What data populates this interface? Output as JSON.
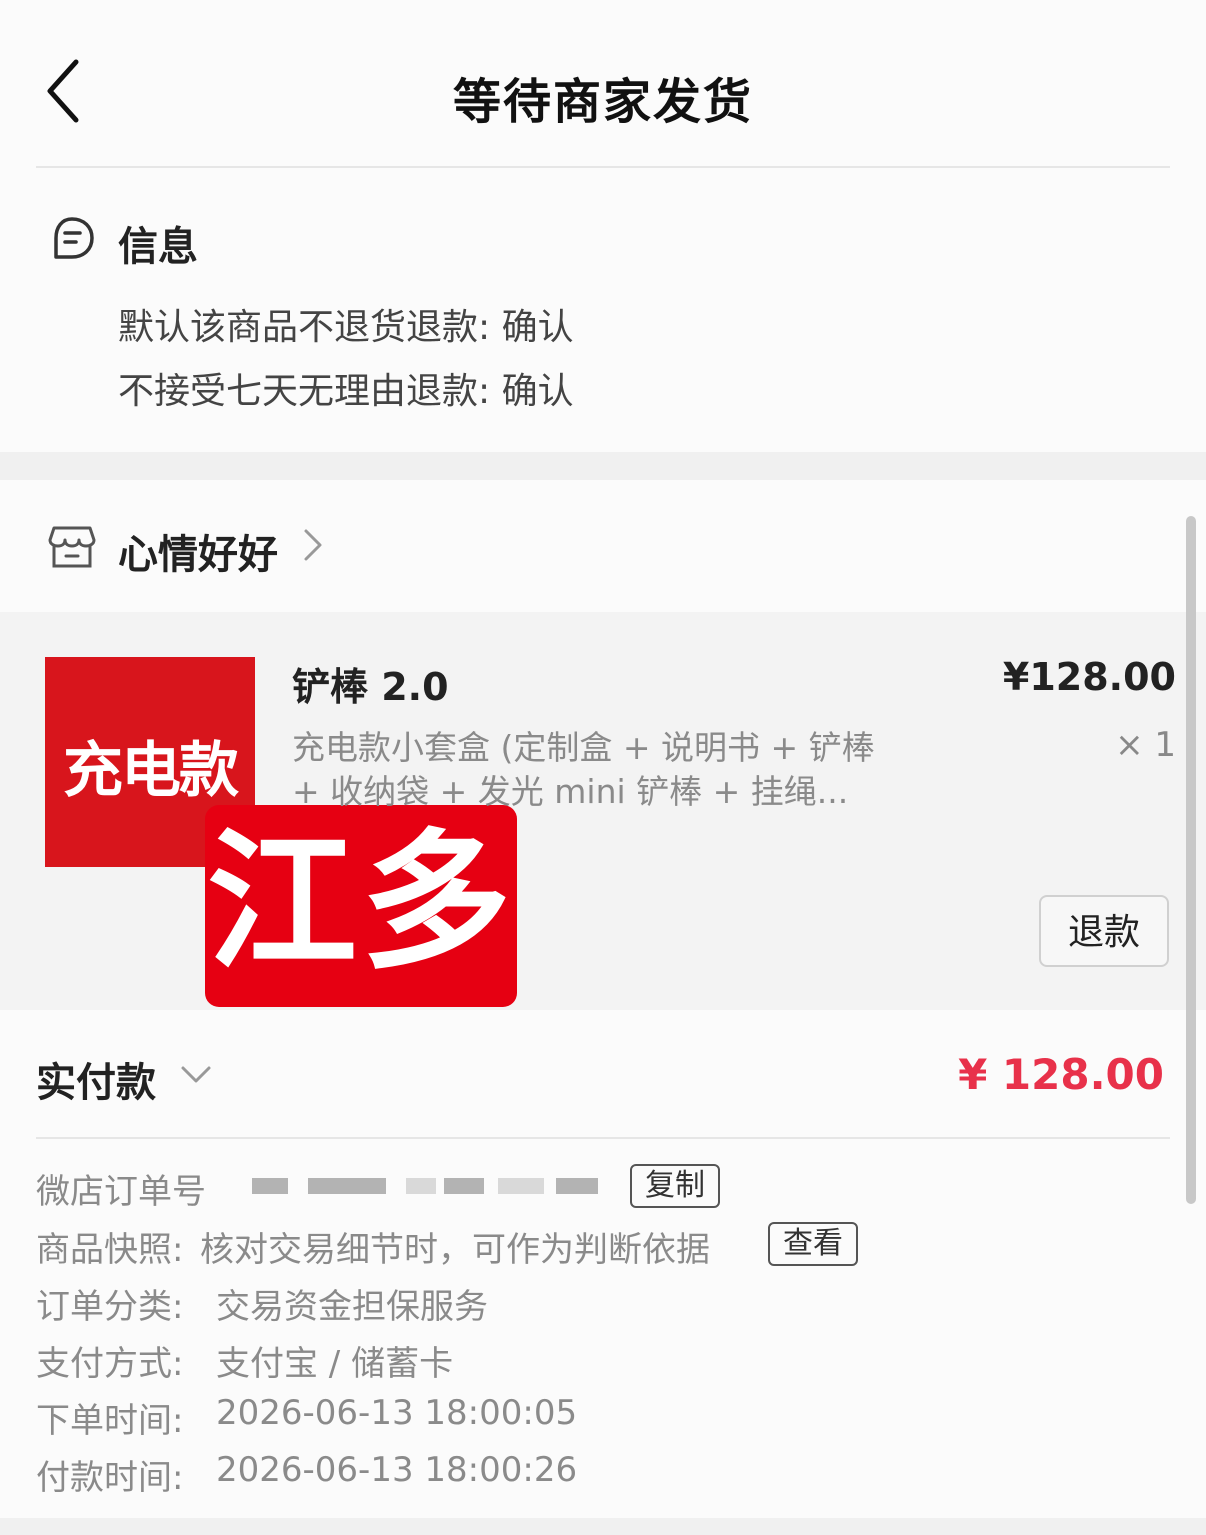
{
  "header": {
    "title": "等待商家发货"
  },
  "info": {
    "title": "信息",
    "lines": [
      "默认该商品不退货退款: 确认",
      "不接受七天无理由退款: 确认"
    ]
  },
  "shop": {
    "name": "心情好好"
  },
  "product": {
    "thumb_text": "充电款",
    "stamp_text": "江多",
    "name": "铲棒 2.0",
    "desc": "充电款小套盒 (定制盒 + 说明书 + 铲棒 + 收纳袋 + 发光 mini 铲棒 + 挂绳...",
    "price": "¥128.00",
    "qty": "× 1",
    "refund_label": "退款"
  },
  "payment": {
    "label": "实付款",
    "amount": "¥ 128.00",
    "amount_color": "#e8314a"
  },
  "details": {
    "order_no_label": "微店订单号",
    "copy_label": "复制",
    "snapshot_label": "商品快照:",
    "snapshot_value": "核对交易细节时，可作为判断依据",
    "view_label": "查看",
    "category_label": "订单分类:",
    "category_value": "交易资金担保服务",
    "pay_method_label": "支付方式:",
    "pay_method_value": "支付宝 / 储蓄卡",
    "order_time_label": "下单时间:",
    "order_time_value": "2026-06-13 18:00:05",
    "pay_time_label": "付款时间:",
    "pay_time_value": "2026-06-13 18:00:26"
  }
}
